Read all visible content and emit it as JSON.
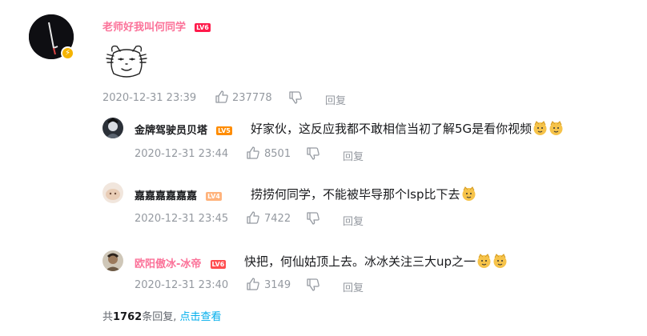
{
  "main_comment": {
    "username": "老师好我叫何同学",
    "level": "LV6",
    "username_color": "#fb7299",
    "time": "2020-12-31 23:39",
    "likes": "237778",
    "reply_label": "回复",
    "sticker": "doge-sticker"
  },
  "replies": [
    {
      "username": "金牌驾驶员贝塔",
      "username_color": "#18191c",
      "level": "LV5",
      "level_color": "#ff8c00",
      "content": "好家伙，这反应我都不敢相信当初了解5G是看你视频",
      "emojis": 2,
      "time": "2020-12-31 23:44",
      "likes": "8501",
      "reply_label": "回复"
    },
    {
      "username": "嘉嘉嘉嘉嘉嘉",
      "username_color": "#18191c",
      "level": "LV4",
      "level_color": "#ffb37c",
      "content": "捞捞何同学，不能被毕导那个lsp比下去",
      "emojis": 1,
      "time": "2020-12-31 23:45",
      "likes": "7422",
      "reply_label": "回复"
    },
    {
      "username": "欧阳傲冰-冰帝",
      "username_color": "#fb7299",
      "level": "LV6",
      "level_color": "#ff4d4f",
      "content": "快把，何仙姑顶上去。冰冰关注三大up之一",
      "emojis": 2,
      "time": "2020-12-31 23:40",
      "likes": "3149",
      "reply_label": "回复"
    }
  ],
  "footer": {
    "prefix": "共",
    "count": "1762",
    "suffix": "条回复,",
    "view_more": "点击查看"
  }
}
